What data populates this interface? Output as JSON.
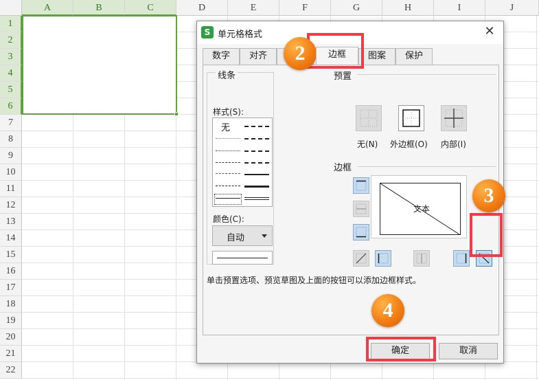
{
  "sheet": {
    "columns": [
      "A",
      "B",
      "C",
      "D",
      "E",
      "F",
      "G",
      "H",
      "I",
      "J"
    ],
    "rows": [
      "1",
      "2",
      "3",
      "4",
      "5",
      "6",
      "7",
      "8",
      "9",
      "10",
      "11",
      "12",
      "13",
      "14",
      "15",
      "16",
      "17",
      "18",
      "19",
      "20",
      "21",
      "22"
    ]
  },
  "dialog": {
    "app_icon": "S",
    "title": "单元格格式",
    "close": "✕",
    "tabs": [
      "数字",
      "对齐",
      "边框",
      "图案",
      "保护"
    ],
    "active_tab": "边框",
    "line_group": {
      "label": "线条",
      "style_label": "样式(S):",
      "style_none": "无",
      "color_label": "颜色(C):",
      "color_value": "自动"
    },
    "presets": {
      "label": "预置",
      "items": [
        "无(N)",
        "外边框(O)",
        "内部(I)"
      ]
    },
    "border": {
      "label": "边框",
      "preview_text": "文本"
    },
    "hint": "单击预置选项、预览草图及上面的按钮可以添加边框样式。",
    "ok_label": "确定",
    "cancel_label": "取消"
  },
  "annotations": {
    "step2": "2",
    "step3": "3",
    "step4": "4",
    "accent_color": "#f03c46",
    "badge_color": "#f07a10"
  }
}
